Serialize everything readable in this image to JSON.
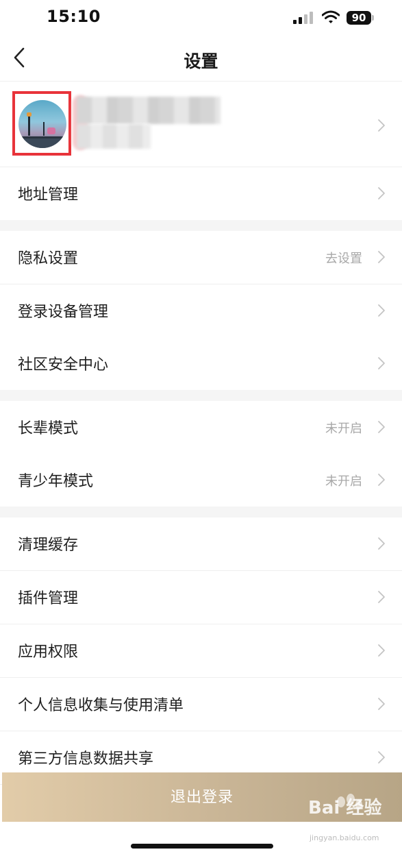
{
  "status_bar": {
    "time": "15:10",
    "battery": "90"
  },
  "nav": {
    "title": "设置"
  },
  "profile": {
    "avatar": "user-avatar",
    "highlight_color": "#e8333a"
  },
  "sections": [
    [
      {
        "label": "地址管理",
        "value": ""
      }
    ],
    [
      {
        "label": "隐私设置",
        "value": "去设置"
      },
      {
        "label": "登录设备管理",
        "value": ""
      },
      {
        "label": "社区安全中心",
        "value": ""
      }
    ],
    [
      {
        "label": "长辈模式",
        "value": "未开启"
      },
      {
        "label": "青少年模式",
        "value": "未开启"
      }
    ],
    [
      {
        "label": "清理缓存",
        "value": ""
      },
      {
        "label": "插件管理",
        "value": ""
      },
      {
        "label": "应用权限",
        "value": ""
      },
      {
        "label": "个人信息收集与使用清单",
        "value": ""
      },
      {
        "label": "第三方信息数据共享",
        "value": ""
      }
    ]
  ],
  "logout": {
    "label": "退出登录",
    "gradient": [
      "#e2cca9",
      "#b7a586"
    ]
  },
  "watermark": {
    "text": "Bai 经验",
    "sub": "jingyan.baidu.com"
  }
}
